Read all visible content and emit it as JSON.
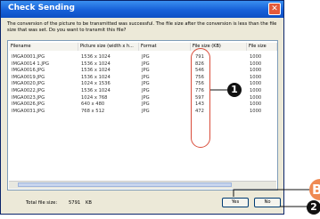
{
  "dialog": {
    "title": "Check Sending",
    "close_symbol": "✕",
    "message": "The conversion of the picture to be transmitted was successful. The file size after the conversion is less than the file size that was set. Do you want to transmit this file?"
  },
  "table": {
    "columns": [
      "Filename",
      "Picture size (width x h...",
      "Format",
      "File size (KB)",
      "File size"
    ],
    "rows": [
      [
        "IMGA0001.JPG",
        "1536 x 1024",
        "JPG",
        "791",
        "1000"
      ],
      [
        "IMGA0014 1.JPG",
        "1536 x 1024",
        "JPG",
        "826",
        "1000"
      ],
      [
        "IMGA0016.JPG",
        "1536 x 1024",
        "JPG",
        "546",
        "1000"
      ],
      [
        "IMGA0019.JPG",
        "1536 x 1024",
        "JPG",
        "756",
        "1000"
      ],
      [
        "IMGA0020.JPG",
        "1024 x 1536",
        "JPG",
        "756",
        "1000"
      ],
      [
        "IMGA0022.JPG",
        "1536 x 1024",
        "JPG",
        "776",
        "1000"
      ],
      [
        "IMGA0023.JPG",
        "1024 x 768",
        "JPG",
        "597",
        "1000"
      ],
      [
        "IMGA0026.JPG",
        "640 x 480",
        "JPG",
        "143",
        "1000"
      ],
      [
        "IMGA0031.JPG",
        "768 x 512",
        "JPG",
        "472",
        "1000"
      ]
    ]
  },
  "footer": {
    "total_label": "Total file size:",
    "total_value": "5791",
    "total_unit": "KB",
    "yes_label": "Yes",
    "no_label": "No"
  },
  "callouts": {
    "one": "1",
    "two": "2",
    "b": "B"
  },
  "colors": {
    "title_bar": "#1660d8",
    "highlight": "#d94c3a",
    "callout_orange": "#ef8a53"
  }
}
